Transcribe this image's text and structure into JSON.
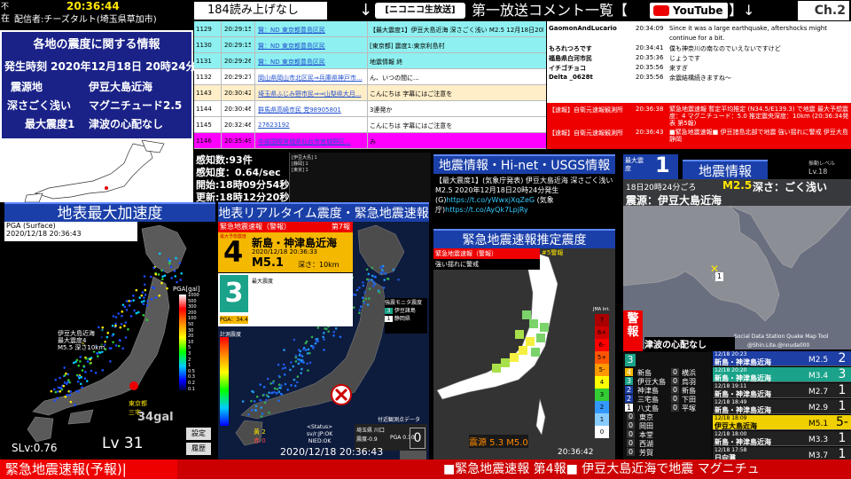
{
  "topleft": {
    "clock": "20:36:44",
    "line1_a": "不",
    "line2_a": "在",
    "broadcaster": "配信者:チーズタルト(埼玉県草加市)"
  },
  "quakeinfo": {
    "title": "各地の震度に関する情報",
    "time": "発生時刻 2020年12月18日 20時24分",
    "epicenter_label": "震源地",
    "epicenter": "伊豆大島近海",
    "depth_label": "深さごく浅い",
    "magnitude": "マグニチュード2.5",
    "maxint_label": "最大震度1",
    "tsunami": "津波の心配なし"
  },
  "header": {
    "yomiage": "184読み上げなし",
    "niconico": "[ニコニコ生放送]",
    "niconico_sub": "NICO NICO",
    "title_left": "↓",
    "title_main": "第一放送コメント一覧【",
    "youtube": "YouTube",
    "title_right": "】↓",
    "channel_badge": "Ch.2"
  },
  "comment_table": [
    {
      "no": "1129",
      "time": "20:29:15",
      "user": "賢：ND 東京都豊島区民",
      "msg": "【最大震度1】伊豆大島近海 深さごく浅い M2.5 12月18日20時24分頃発生"
    },
    {
      "no": "1130",
      "time": "20:29:15",
      "user": "賢：ND 東京都豊島区民",
      "msg": "[東京都] 震度1:東京利島村"
    },
    {
      "no": "1131",
      "time": "20:29:26",
      "user": "賢：ND 東京都豊島区民",
      "msg": "地震情報 終"
    },
    {
      "no": "1132",
      "time": "20:29:27",
      "user": "岡山県岡山市北区民⇒兵庫県神戸市...",
      "msg": "ん、いつの間に..."
    },
    {
      "no": "1143",
      "time": "20:30:42",
      "user": "埼玉県ふじみ野市民⇒⇒山梨県大月...",
      "msg": "こんにちは 字幕にはご注意を"
    },
    {
      "no": "1144",
      "time": "20:30:46",
      "user": "群馬県高崎市民 党98905801",
      "msg": "3連発か"
    },
    {
      "no": "1145",
      "time": "20:32:46",
      "user": "27623192",
      "msg": "こんにちは 字幕にはご注意を"
    },
    {
      "no": "1146",
      "time": "20:35:49",
      "user": "中部国際宮城県仙台市宮城野区...",
      "msg": "み"
    }
  ],
  "yt_comments": [
    {
      "user": "GaomonAndLucario",
      "time": "20:34:09",
      "msg": "Since it was a large earthquake, aftershocks might"
    },
    {
      "user": "",
      "time": "",
      "msg": "continue for a bit."
    },
    {
      "user": "もろれつろです",
      "time": "20:34:41",
      "msg": "僕も神奈川の南なのでいえないですけど"
    },
    {
      "user": "福島県白河市民",
      "time": "20:35:36",
      "msg": "じょうです"
    },
    {
      "user": "イチゴチョコ",
      "time": "20:35:56",
      "msg": "来すぎ"
    },
    {
      "user": "Delta _0628t",
      "time": "20:35:56",
      "msg": "余震結構続きますね～"
    }
  ],
  "yt_alerts": [
    {
      "user": "【速報】自衛元速報観測所",
      "time": "20:36:38",
      "msg": "緊急地震速報 暫定平均推定 (N34.5/E139.3) で地震 最大予想震度：4 マグニチュード：5.0 推定震央深度：10km (20:36:34発表 第5報)"
    },
    {
      "user": "【速報】自衛元速報観測所",
      "time": "20:36:43",
      "msg": "■緊急地震速報■ 伊豆諸島北部で地震 強い揺れに警戒 伊豆大島 静岡"
    }
  ],
  "stats": {
    "kanchi": "感知数:93件",
    "rate": "感知度：0.64/sec",
    "start": "開始:18時09分54秒",
    "update": "更新:18時12分20秒",
    "notes": [
      "[伊豆大島] 1",
      "[静岡] 1",
      "[東京] 1"
    ]
  },
  "panels": {
    "pga_title": "地表最大加速度",
    "rt_title": "地表リアルタイム震度・緊急地震速報",
    "quake_title": "地震情報・Hi-net・USGS情報",
    "eew_est_title": "緊急地震速報推定震度",
    "quakeinfo_title": "地震情報",
    "bottom_banner": "緊急地震速報(予報)|",
    "ticker": "■緊急地震速報 第4報■ 伊豆大島近海で地震 マグニチュ"
  },
  "pga": {
    "label": "PGA (Surface)",
    "datetime": "2020/12/18 20:36:43",
    "scale_label": "PGA[gal]",
    "scale": [
      "1000",
      "500",
      "300",
      "200",
      "100",
      "50",
      "30",
      "20",
      "10",
      "5",
      "3",
      "2",
      "1",
      "0.5",
      "0.3",
      "0.2",
      "0.1"
    ],
    "annotation1": "伊豆大島近海",
    "annotation2": "最大震度4",
    "annotation3": "M5.5 深さ10km",
    "tokyo": "東京都",
    "tokyo_sub": "三宅",
    "gal": "34gal",
    "slv": "SLv:0.76",
    "lv": "Lv 31",
    "btn1": "設定",
    "btn2": "履歴"
  },
  "rt": {
    "eew_head": "緊急地震速報（警報）",
    "report_no": "第7報",
    "max_label": "最大予想震度",
    "max_int": "4",
    "region": "新島・神津島近海",
    "eew_time": "2020/12/18 20:36:33",
    "mag": "M5.1",
    "depth": "深さ：10km",
    "int3": "3",
    "int3_label": "最大震度",
    "pga_badge": "PGA：34.4",
    "keisoku": "計測震度",
    "monitor_label": "強震モニタ震度",
    "obs": [
      {
        "int": "3",
        "name": "伊豆諸島"
      },
      {
        "int": "1",
        "name": "静岡県"
      }
    ],
    "status": "<Status>",
    "status2": "sv/r:JP:OK",
    "status3": "NIED:OK",
    "yellow": "黄 2",
    "red": "赤 0",
    "shindo": "震度-0.9",
    "pga": "PGA 0.10",
    "tsuki": "付近観測点データ",
    "obs_place": "埼玉県 川口",
    "obs_zero": "0",
    "datetime": "2020/12/18 20:36:43"
  },
  "usgs": {
    "text1": "【最大震度1】(気象庁発表) 伊豆大島近海 深さごく浅い M2.5 2020年12月18日20時24分発生 (G)",
    "link1": "https://t.co/yWwxjXqZeG",
    "text2": "(気象庁)",
    "link2": "https://t.co/AyQk7LpjRy"
  },
  "est": {
    "banner": "緊急地震速報（警報）",
    "banner2": "強い揺れに警戒",
    "report": "#5警報",
    "scale_label": "JMA Int.",
    "scale": [
      "7",
      "6+",
      "6-",
      "5+",
      "5-",
      "4",
      "3",
      "2",
      "1",
      "0"
    ],
    "time": "20:36:42",
    "bottom_text": "震源 5.3 M5.0"
  },
  "qi": {
    "max_label": "最大震度",
    "max_int": "1",
    "level_label": "振動レベル",
    "level": "Lv.18",
    "time": "18日20時24分ごろ",
    "mag": "M2.5",
    "depth": "深さ：ごく浅い",
    "epicenter": "震源：伊豆大島近海",
    "keihou_label": "警報",
    "tsunami": "津波の心配なし",
    "credit": "Social Data Station Quake Map Tool",
    "handle": "@Shin.Lite.@nnuda000",
    "legend_int": "3",
    "legend_int2": "1",
    "areas": [
      {
        "int": "4",
        "name": "新島"
      },
      {
        "int": "3",
        "name": "伊豆大島"
      },
      {
        "int": "2",
        "name": "神津島"
      },
      {
        "int": "2",
        "name": "三宅島"
      },
      {
        "int": "1",
        "name": "八丈島"
      },
      {
        "int": "0",
        "name": "東京"
      },
      {
        "int": "0",
        "name": "岡田"
      },
      {
        "int": "0",
        "name": "本堂"
      },
      {
        "int": "0",
        "name": "西湖"
      },
      {
        "int": "0",
        "name": "芳賀"
      },
      {
        "int": "0",
        "name": "横浜"
      },
      {
        "int": "0",
        "name": "烏羽"
      },
      {
        "int": "0",
        "name": "新島"
      },
      {
        "int": "0",
        "name": "下田"
      },
      {
        "int": "0",
        "name": "平塚"
      }
    ]
  },
  "history": [
    {
      "time": "12/18 20:23",
      "place": "新島・神津島近海",
      "mag": "M2.5",
      "int": "2",
      "color": "#1e3fa6"
    },
    {
      "time": "12/18 20:20",
      "place": "新島・神津島近海",
      "mag": "M3.4",
      "int": "3",
      "color": "#1aa38a"
    },
    {
      "time": "12/18 19:11",
      "place": "新島・神津島近海",
      "mag": "M2.7",
      "int": "1",
      "color": "#222"
    },
    {
      "time": "12/18 18:49",
      "place": "新島・神津島近海",
      "mag": "M2.9",
      "int": "1",
      "color": "#222"
    },
    {
      "time": "12/18 18:09",
      "place": "伊豆大島近海",
      "mag": "M5.1",
      "int": "5-",
      "color": "#f0d000"
    },
    {
      "time": "12/18 18:00",
      "place": "新島・神津島近海",
      "mag": "M3.3",
      "int": "1",
      "color": "#222"
    },
    {
      "time": "12/18 17:58",
      "place": "日向灘",
      "mag": "M3.7",
      "int": "1",
      "color": "#222"
    }
  ]
}
